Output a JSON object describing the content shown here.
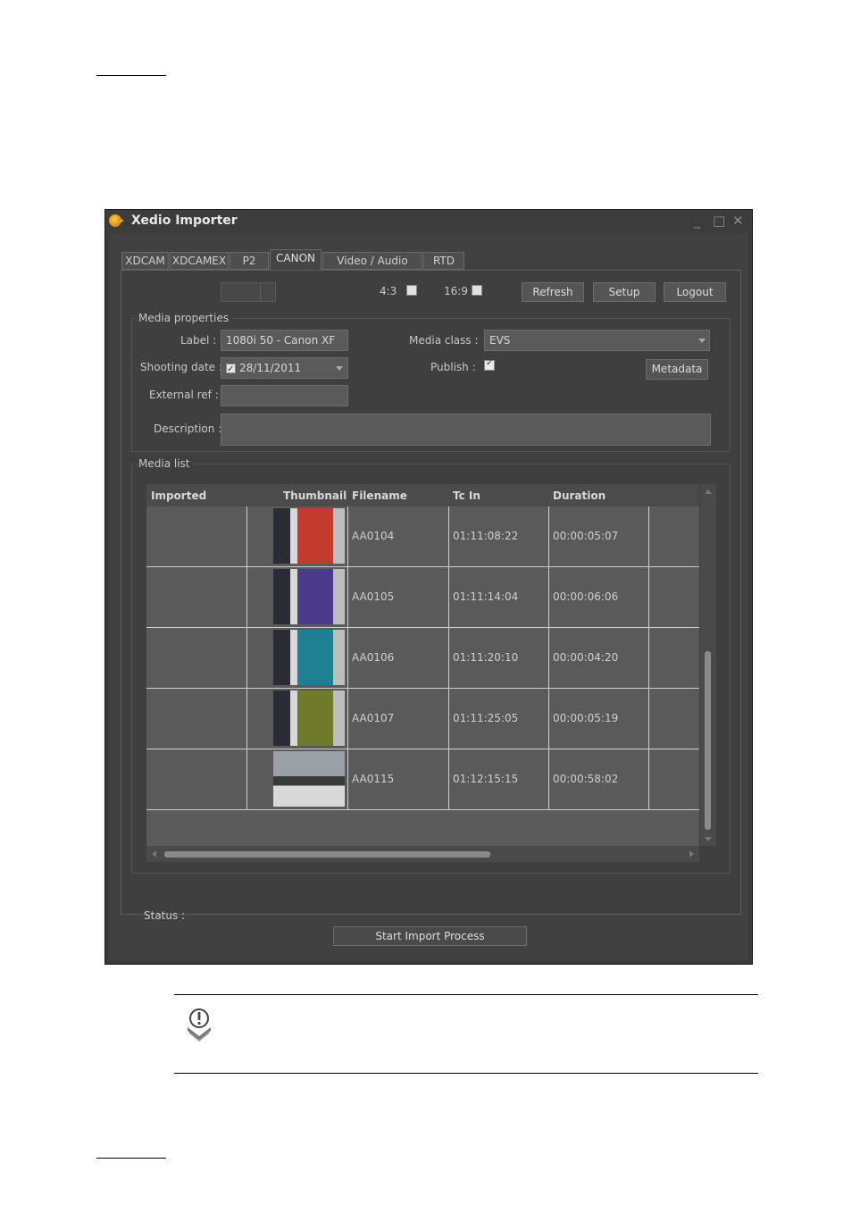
{
  "window": {
    "title": "Xedio Importer",
    "controls": {
      "minimize": "_",
      "maximize": "□",
      "close": "✕"
    }
  },
  "tabs": [
    {
      "label": "XDCAM"
    },
    {
      "label": "XDCAMEX"
    },
    {
      "label": "P2"
    },
    {
      "label": "CANON",
      "active": true
    },
    {
      "label": "Video / Audio /Stills"
    },
    {
      "label": "RTD"
    }
  ],
  "toolbar": {
    "ratio_4_3": "4:3",
    "ratio_16_9": "16:9",
    "refresh": "Refresh",
    "setup": "Setup",
    "logout": "Logout"
  },
  "media_properties": {
    "group_title": "Media properties",
    "label_label": "Label :",
    "label_value": "1080i 50 - Canon XF",
    "shooting_date_label": "Shooting date :",
    "shooting_date_value": "28/11/2011",
    "external_ref_label": "External ref :",
    "external_ref_value": "",
    "description_label": "Description :",
    "description_value": "",
    "media_class_label": "Media class :",
    "media_class_value": "EVS",
    "publish_label": "Publish :",
    "publish_checked": true,
    "metadata_button": "Metadata"
  },
  "media_list": {
    "group_title": "Media list",
    "columns": [
      "Imported",
      "Thumbnail",
      "Filename",
      "Tc In",
      "Duration"
    ],
    "rows": [
      {
        "filename": "AA0104",
        "tc_in": "01:11:08:22",
        "duration": "00:00:05:07",
        "thumb_color": "#c43a2e"
      },
      {
        "filename": "AA0105",
        "tc_in": "01:11:14:04",
        "duration": "00:00:06:06",
        "thumb_color": "#4a3a8a"
      },
      {
        "filename": "AA0106",
        "tc_in": "01:11:20:10",
        "duration": "00:00:04:20",
        "thumb_color": "#1f7f93"
      },
      {
        "filename": "AA0107",
        "tc_in": "01:11:25:05",
        "duration": "00:00:05:19",
        "thumb_color": "#6f7a2a"
      },
      {
        "filename": "AA0115",
        "tc_in": "01:12:15:15",
        "duration": "00:00:58:02",
        "thumb_color": "#8a8a8a"
      }
    ]
  },
  "status": {
    "label": "Status :",
    "value": ""
  },
  "start_button": "Start Import Process"
}
